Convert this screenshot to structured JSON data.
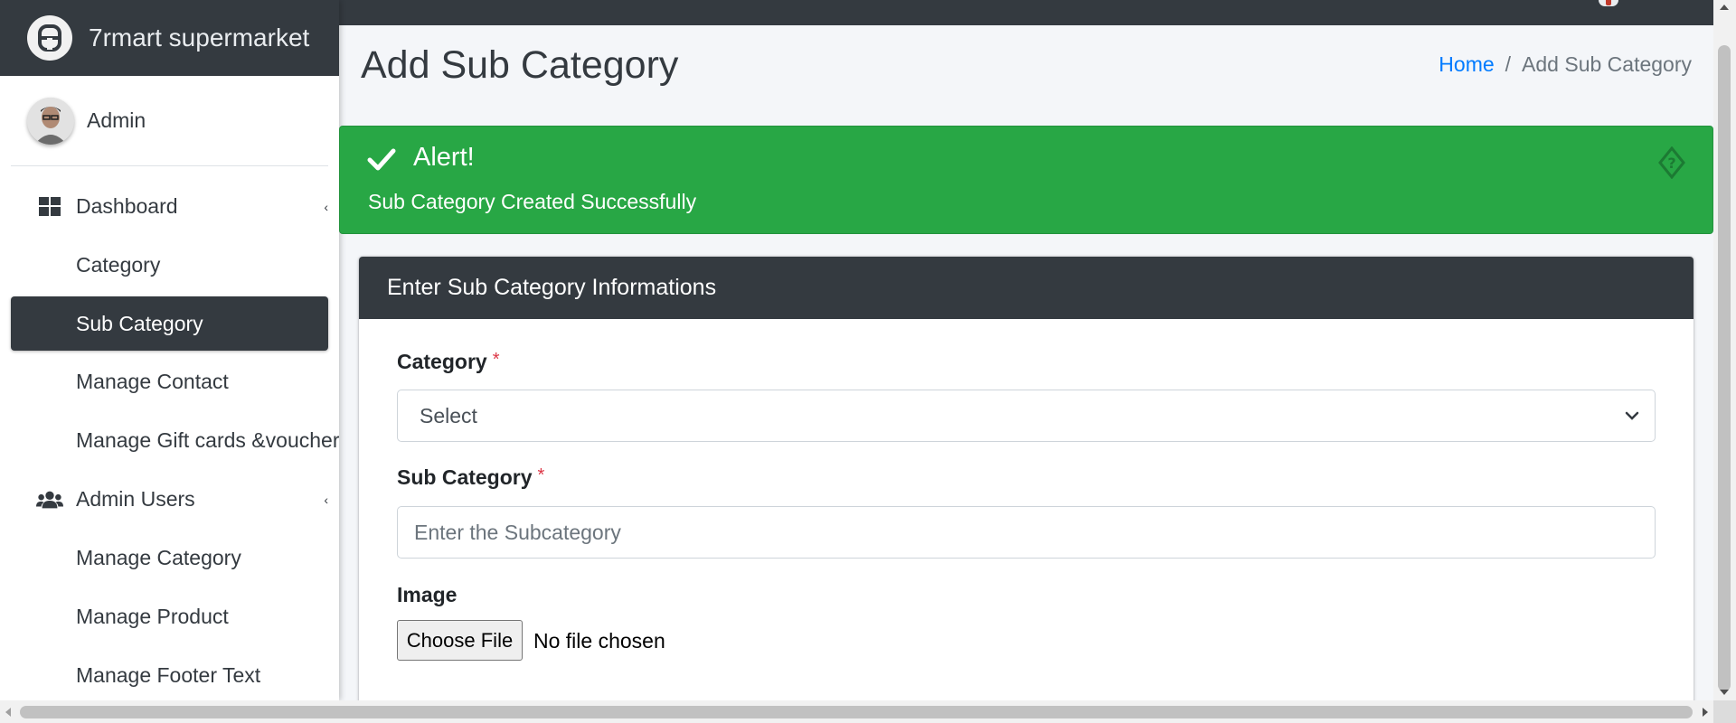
{
  "brand": {
    "name": "7rmart supermarket",
    "icon": "brand-logo-icon"
  },
  "user": {
    "name": "Admin",
    "icon": "user-avatar"
  },
  "sidebar": {
    "items": [
      {
        "label": "Dashboard",
        "icon": "dashboard-icon",
        "caret": "‹"
      },
      {
        "label": "Category"
      },
      {
        "label": "Sub Category",
        "active": true
      },
      {
        "label": "Manage Contact"
      },
      {
        "label": "Manage Gift cards &voucher"
      },
      {
        "label": "Admin Users",
        "icon": "users-icon",
        "caret": "‹"
      },
      {
        "label": "Manage Category"
      },
      {
        "label": "Manage Product"
      },
      {
        "label": "Manage Footer Text"
      }
    ]
  },
  "header": {
    "title": "Add Sub Category",
    "breadcrumb": {
      "home": "Home",
      "separator": "/",
      "current": "Add Sub Category"
    }
  },
  "alert": {
    "title": "Alert!",
    "message": "Sub Category Created Successfully",
    "color": "#28a745",
    "icon": "check-icon",
    "close_icon": "close-icon"
  },
  "form": {
    "header": "Enter Sub Category Informations",
    "category": {
      "label": "Category",
      "required_mark": "*",
      "selected": "Select"
    },
    "subcategory": {
      "label": "Sub Category",
      "required_mark": "*",
      "placeholder": "Enter the Subcategory",
      "value": ""
    },
    "image": {
      "label": "Image",
      "button": "Choose File",
      "status": "No file chosen"
    }
  },
  "colors": {
    "dark": "#343a40",
    "link": "#007bff",
    "required": "#dc3545"
  }
}
